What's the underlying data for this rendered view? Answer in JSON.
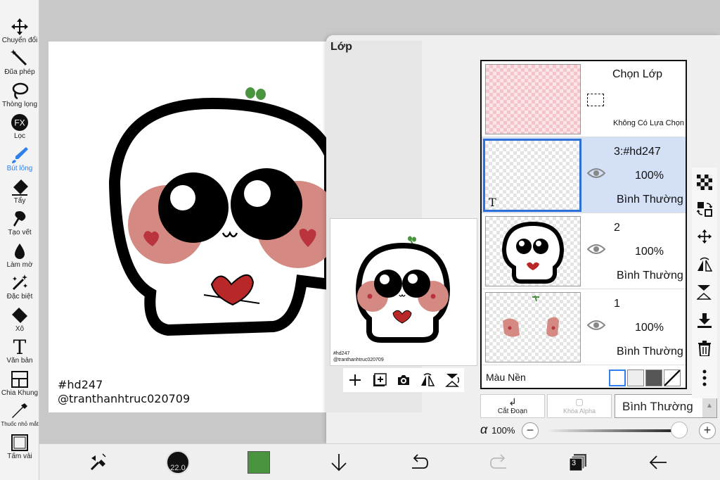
{
  "toolbar": {
    "tools": [
      {
        "label": "Chuyển đổi",
        "icon": "move-icon"
      },
      {
        "label": "Đũa phép",
        "icon": "magic-wand-icon"
      },
      {
        "label": "Thòng lọng",
        "icon": "lasso-icon"
      },
      {
        "label": "Lọc",
        "icon": "fx-filter-icon",
        "glyph": "FX"
      },
      {
        "label": "Bút lông",
        "icon": "brush-icon",
        "active": true
      },
      {
        "label": "Tẩy",
        "icon": "eraser-icon"
      },
      {
        "label": "Tạo vết",
        "icon": "smudge-icon"
      },
      {
        "label": "Làm mờ",
        "icon": "blur-drop-icon"
      },
      {
        "label": "Đặc biệt",
        "icon": "special-brush-icon"
      },
      {
        "label": "Xô",
        "icon": "bucket-icon"
      },
      {
        "label": "Văn bản",
        "icon": "text-icon",
        "glyph": "T"
      },
      {
        "label": "Chia Khung",
        "icon": "frame-divider-icon"
      },
      {
        "label": "Thuốc nhỏ mắt",
        "icon": "eyedropper-icon"
      },
      {
        "label": "Tấm vải",
        "icon": "canvas-icon"
      }
    ]
  },
  "canvas": {
    "text_line1": "#hd247",
    "text_line2": "@tranthanhtruc020709"
  },
  "layer_panel": {
    "title": "Lớp",
    "preview_text_line1": "#hd247",
    "preview_text_line2": "@tranthanhtruc020709",
    "selection_layer": {
      "title": "Chọn Lớp",
      "status": "Không Có Lựa Chọn"
    },
    "layers": [
      {
        "name": "3:#hd247",
        "opacity": "100%",
        "blend": "Bình Thường",
        "selected": true,
        "badge": "T"
      },
      {
        "name": "2",
        "opacity": "100%",
        "blend": "Bình Thường",
        "selected": false
      },
      {
        "name": "1",
        "opacity": "100%",
        "blend": "Bình Thường",
        "selected": false
      }
    ],
    "background_label": "Màu Nền",
    "clip_label": "Cắt Đoạn",
    "alpha_lock_label": "Khóa Alpha",
    "blend_mode": "Bình Thường",
    "alpha_symbol": "α",
    "opacity_value": "100%",
    "opacity_fraction": 1.0,
    "minus": "−",
    "plus": "+",
    "layer_count": "3",
    "brush_size": "22.0"
  },
  "colors": {
    "primary_color": "#4a9440",
    "accent": "#2f80ed",
    "selected_row": "#d3e0f6"
  }
}
